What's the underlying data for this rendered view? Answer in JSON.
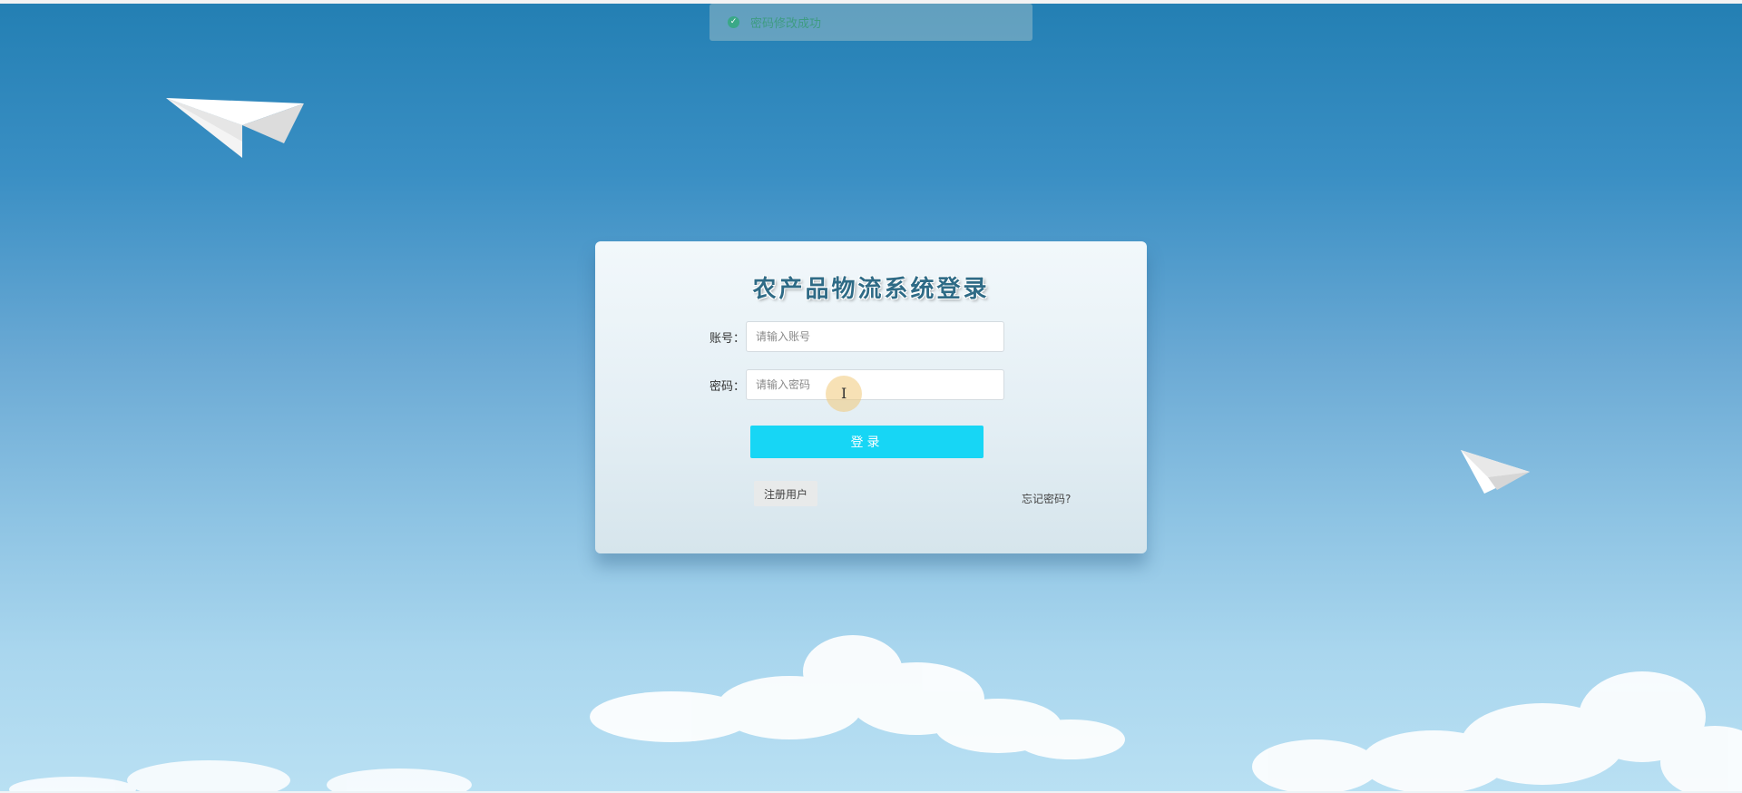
{
  "toast": {
    "icon": "check-circle-icon",
    "message": "密码修改成功",
    "color": "#3aa887"
  },
  "login": {
    "title": "农产品物流系统登录",
    "account_label": "账号：",
    "account_placeholder": "请输入账号",
    "password_label": "密码：",
    "password_placeholder": "请输入密码",
    "submit_label": "登录",
    "register_label": "注册用户",
    "forgot_label": "忘记密码?"
  },
  "colors": {
    "sky_top": "#237fb3",
    "sky_bottom": "#b9e0f3",
    "button": "#17d6f5"
  }
}
